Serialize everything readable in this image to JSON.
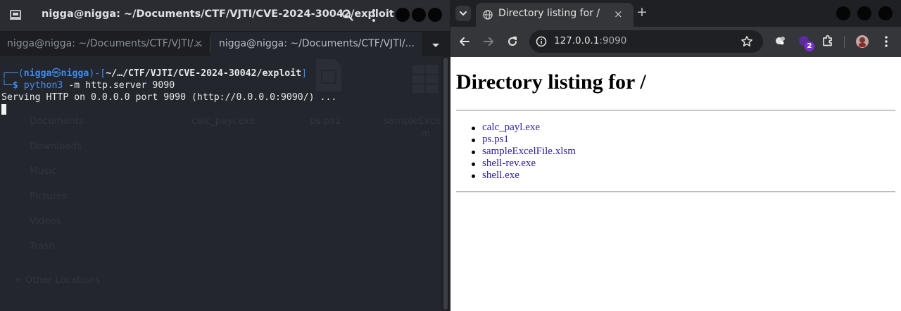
{
  "terminal": {
    "title": "nigga@nigga: ~/Documents/CTF/VJTI/CVE-2024-30042/exploit",
    "tabs": [
      {
        "label": "nigga@nigga: ~/Documents/CTF/VJTI/...",
        "close": "×"
      },
      {
        "label": "nigga@nigga: ~/Documents/CTF/VJTI/...",
        "close": "×"
      }
    ],
    "prompt": {
      "corner": "┌──(",
      "user": "nigga",
      "at_symbol": "㉿",
      "host": "nigga",
      "mid": ")-[",
      "cwd": "~/…/CTF/VJTI/CVE-2024-30042/exploit",
      "end": "]",
      "corner2": "└─",
      "dollar": "$",
      "command": "python3",
      "args": " -m http.server 9090"
    },
    "output_line": "Serving HTTP on 0.0.0.0 port 9090 (http://0.0.0.0:9090/) ...",
    "ghost_files": [
      "calc_payl.exe",
      "ps.ps1",
      "sampleExcelFi",
      "m"
    ],
    "ghost_sidebar": [
      "Documents",
      "Downloads",
      "Music",
      "Pictures",
      "Videos",
      "Trash",
      "+  Other Locations"
    ]
  },
  "browser": {
    "tab_title": "Directory listing for /",
    "tab_close": "×",
    "new_tab": "+",
    "url_host": "127.0.0.1",
    "url_port": ":9090",
    "extension_badge": "2",
    "page": {
      "heading": "Directory listing for /",
      "files": [
        "calc_payl.exe",
        "ps.ps1",
        "sampleExcelFile.xlsm",
        "shell-rev.exe",
        "shell.exe"
      ]
    }
  },
  "colors": {
    "terminal_bg": "#23262c",
    "prompt_blue": "#3d8bf0",
    "link": "#2a1fa0",
    "chrome_dark": "#35363a"
  }
}
